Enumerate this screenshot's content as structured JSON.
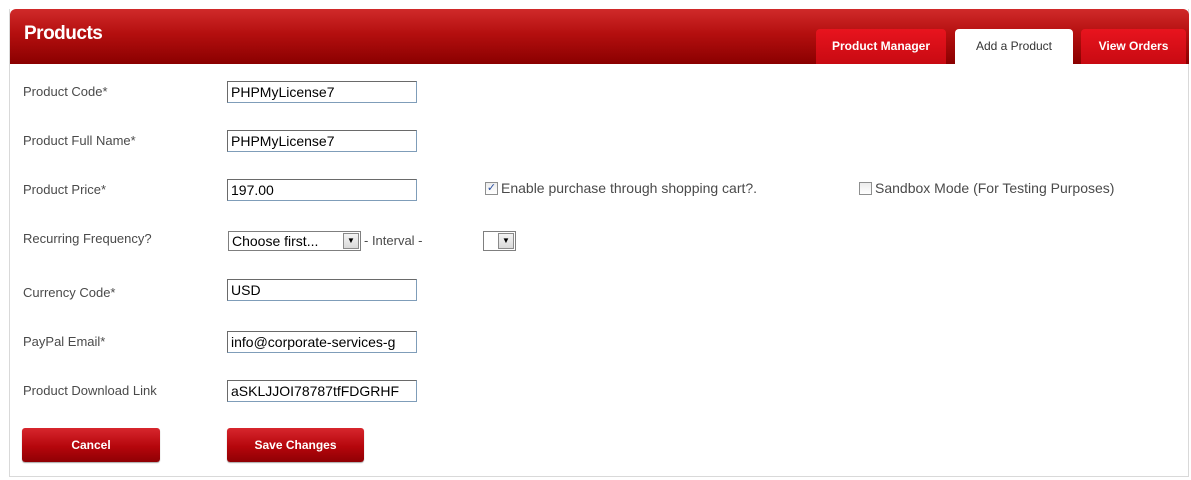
{
  "header": {
    "title": "Products"
  },
  "tabs": [
    {
      "label": "Product Manager",
      "active": false
    },
    {
      "label": "Add a Product",
      "active": true
    },
    {
      "label": "View Orders",
      "active": false
    }
  ],
  "form": {
    "product_code": {
      "label": "Product Code*",
      "value": "PHPMyLicense7"
    },
    "product_full_name": {
      "label": "Product Full Name*",
      "value": "PHPMyLicense7"
    },
    "product_price": {
      "label": "Product Price*",
      "value": "197.00"
    },
    "enable_cart": {
      "label": "Enable purchase through shopping cart?.",
      "checked": true
    },
    "sandbox_mode": {
      "label": "Sandbox Mode (For Testing Purposes)",
      "checked": false
    },
    "recurring_frequency": {
      "label": "Recurring Frequency?",
      "selected": "Choose first...",
      "interval_label": "- Interval -",
      "interval_selected": ""
    },
    "currency_code": {
      "label": "Currency Code*",
      "value": "USD"
    },
    "paypal_email": {
      "label": "PayPal Email*",
      "value": "info@corporate-services-g"
    },
    "product_download_link": {
      "label": "Product Download Link",
      "value": "aSKLJJOI78787tfFDGRHF"
    }
  },
  "buttons": {
    "cancel": "Cancel",
    "save": "Save Changes"
  },
  "icons": {
    "dropdown": "chevron-down-icon",
    "check": "checkmark-icon"
  },
  "colors": {
    "header_red": "#b40f0f",
    "tab_red": "#e8141e",
    "button_red": "#b5060c"
  }
}
